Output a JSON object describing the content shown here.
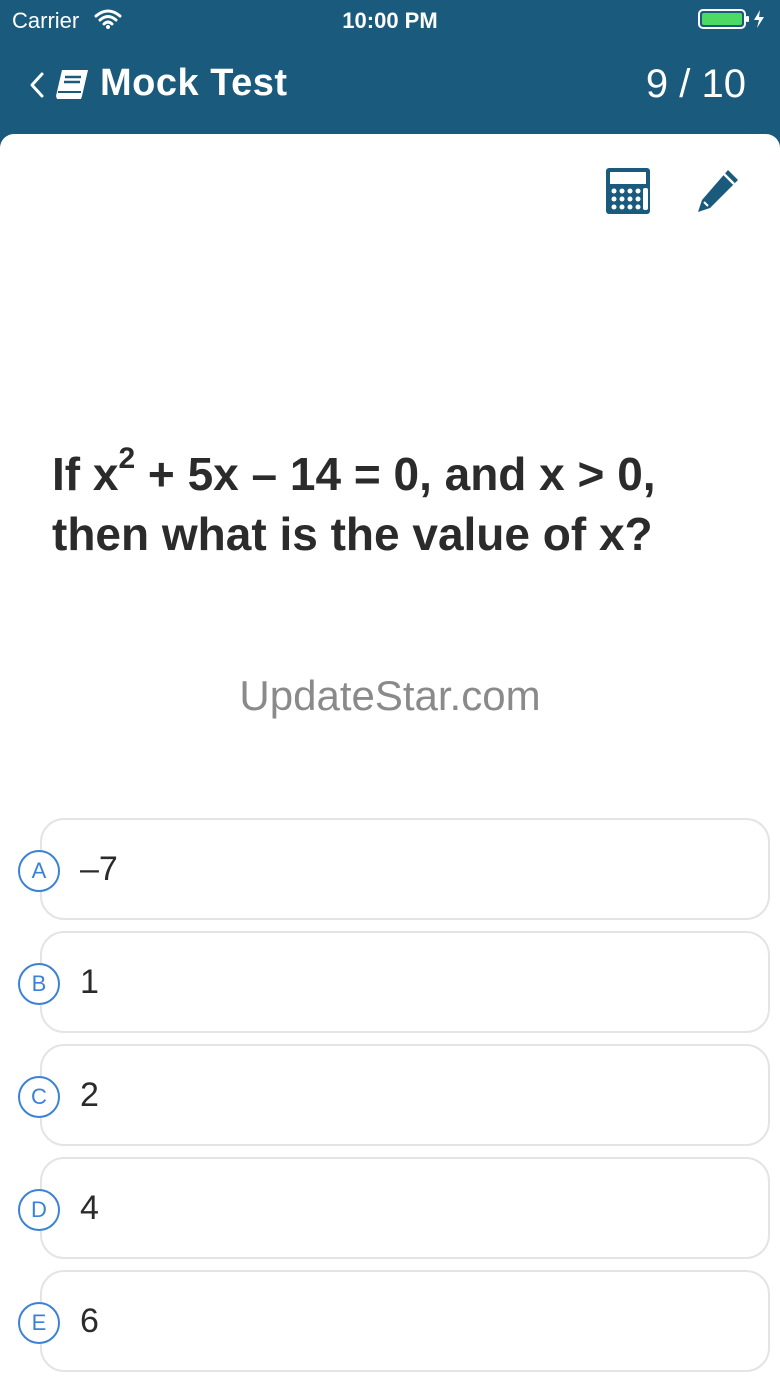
{
  "status_bar": {
    "carrier": "Carrier",
    "time": "10:00 PM",
    "battery_color": "#4cd964"
  },
  "nav": {
    "title": "Mock Test",
    "progress": "9 / 10"
  },
  "question": {
    "text_before_sup": "If x",
    "sup": "2",
    "text_after_sup": " + 5x – 14 = 0, and x > 0, then what is the value of x?"
  },
  "watermark": "UpdateStar.com",
  "options": [
    {
      "letter": "A",
      "value": "–7"
    },
    {
      "letter": "B",
      "value": "1"
    },
    {
      "letter": "C",
      "value": "2"
    },
    {
      "letter": "D",
      "value": "4"
    },
    {
      "letter": "E",
      "value": "6"
    }
  ],
  "colors": {
    "header": "#1a5a7c",
    "accent": "#3b82d6",
    "icon": "#1a5a7c"
  }
}
